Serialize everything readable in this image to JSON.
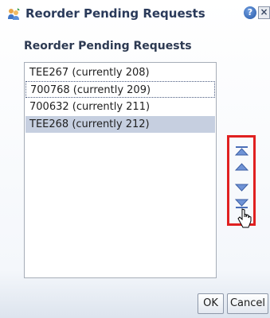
{
  "dialog": {
    "title": "Reorder Pending Requests",
    "help_symbol": "?",
    "close_symbol": "×"
  },
  "list": {
    "label": "Reorder Pending Requests",
    "items": [
      {
        "label": "TEE267 (currently 208)",
        "state": "normal"
      },
      {
        "label": "700768 (currently 209)",
        "state": "focused"
      },
      {
        "label": "700632 (currently 211)",
        "state": "normal"
      },
      {
        "label": "TEE268 (currently 212)",
        "state": "selected"
      }
    ]
  },
  "reorder_buttons": [
    "move-top-icon",
    "move-up-icon",
    "move-down-icon",
    "move-bottom-icon"
  ],
  "footer": {
    "ok_label": "OK",
    "cancel_label": "Cancel"
  },
  "colors": {
    "highlight_border": "#e02020",
    "selected_row": "#c6cfe0",
    "arrow_fill": "#4a6fb8"
  }
}
